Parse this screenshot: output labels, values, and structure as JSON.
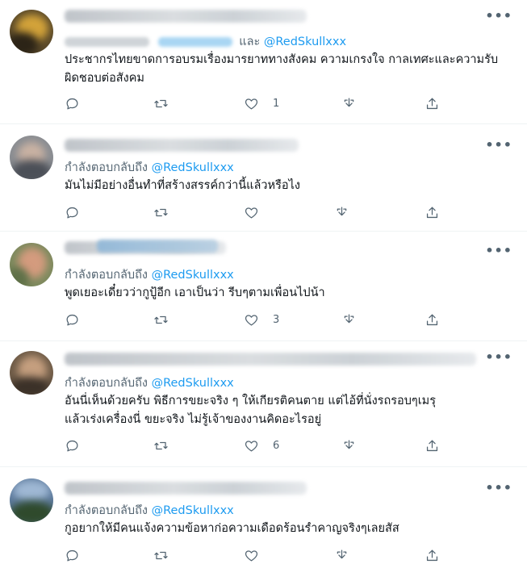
{
  "tweets": [
    {
      "reply_prefix": "และ",
      "mention": "@RedSkullxxx",
      "text": "ประชากรไทยขาดการอบรมเรื่องมารยาททางสังคม ความเกรงใจ กาลเทศะและความรับผิดชอบต่อสังคม",
      "reply_count": "",
      "retweet_count": "",
      "like_count": "1"
    },
    {
      "reply_prefix": "กำลังตอบกลับถึง",
      "mention": "@RedSkullxxx",
      "text": "มันไม่มีอย่างอื่นทำที่สร้างสรรค์กว่านี้แล้วหรือไง",
      "reply_count": "",
      "retweet_count": "",
      "like_count": ""
    },
    {
      "reply_prefix": "กำลังตอบกลับถึง",
      "mention": "@RedSkullxxx",
      "text": "พูดเยอะเดี๋ยวว่ากูปู้อีก เอาเป็นว่า รีบๆตามเพื่อนไปน้า",
      "reply_count": "",
      "retweet_count": "",
      "like_count": "3"
    },
    {
      "reply_prefix": "กำลังตอบกลับถึง",
      "mention": "@RedSkullxxx",
      "text": "อันนี่เห็นด้วยครับ พิธีการขยะจริง ๆ ให้เกียรติคนตาย แต่ไอ้ที่นั่งรถรอบๆเมรุแล้วเร่งเครื่องนี่ ขยะจริง ไม่รู้เจ้าของงานคิดอะไรอยู่",
      "reply_count": "",
      "retweet_count": "",
      "like_count": "6"
    },
    {
      "reply_prefix": "กำลังตอบกลับถึง",
      "mention": "@RedSkullxxx",
      "text": "กูอยากให้มีคนแจ้งความข้อหาก่อความเดือดร้อนรำคาญจริงๆเลยสัส",
      "reply_count": "",
      "retweet_count": "",
      "like_count": ""
    }
  ],
  "icons": {
    "reply": "reply-icon",
    "retweet": "retweet-icon",
    "like": "like-icon",
    "share": "share-icon",
    "upload": "upload-icon",
    "more": "more-icon"
  },
  "more_label": "•••",
  "colors": {
    "mention": "#1d9bf0",
    "secondary": "#536471",
    "text": "#0f1419",
    "divider": "#eff3f4"
  }
}
